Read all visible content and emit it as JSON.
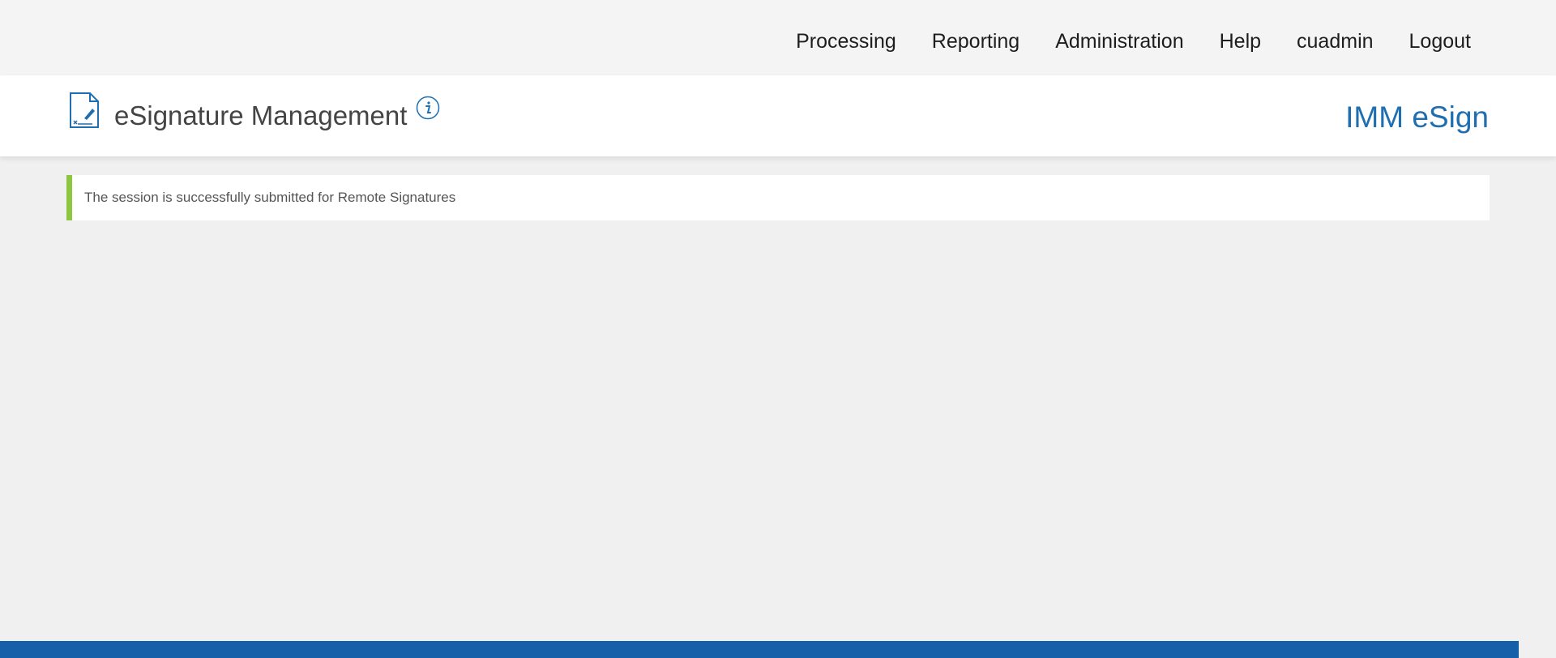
{
  "topnav": {
    "items": [
      {
        "label": "Processing"
      },
      {
        "label": "Reporting"
      },
      {
        "label": "Administration"
      },
      {
        "label": "Help"
      },
      {
        "label": "cuadmin"
      },
      {
        "label": "Logout"
      }
    ]
  },
  "header": {
    "title": "eSignature Management",
    "brand": "IMM eSign",
    "icons": {
      "app": "signature-document-icon",
      "info": "info-icon"
    }
  },
  "message": {
    "text": "The session is successfully submitted for Remote Signatures",
    "status": "success"
  },
  "colors": {
    "brand": "#1f6fb0",
    "success_accent": "#8dc63f",
    "footer": "#1560a8"
  }
}
